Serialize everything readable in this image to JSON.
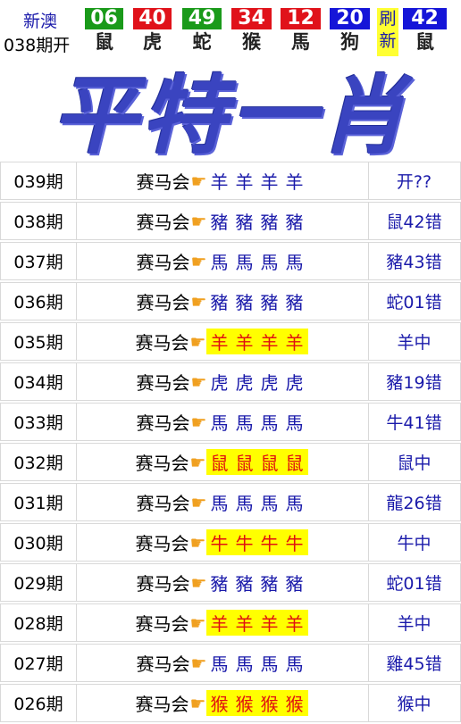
{
  "header": {
    "brand": "新澳",
    "period_open": "038期开",
    "balls": [
      {
        "num": "06",
        "zodiac": "鼠",
        "color": "#1a9a1a"
      },
      {
        "num": "40",
        "zodiac": "虎",
        "color": "#e0121a"
      },
      {
        "num": "49",
        "zodiac": "蛇",
        "color": "#1a9a1a"
      },
      {
        "num": "34",
        "zodiac": "猴",
        "color": "#e0121a"
      },
      {
        "num": "12",
        "zodiac": "馬",
        "color": "#e0121a"
      },
      {
        "num": "20",
        "zodiac": "狗",
        "color": "#1515d8"
      }
    ],
    "refresh_top": "刷",
    "refresh_bottom": "新",
    "special": {
      "num": "42",
      "zodiac": "鼠",
      "color": "#1515d8"
    }
  },
  "banner": {
    "title": "平特一肖"
  },
  "rows": [
    {
      "period": "039期",
      "source": "赛马会",
      "picks": [
        "羊",
        "羊",
        "羊",
        "羊"
      ],
      "hit": false,
      "result": "开??"
    },
    {
      "period": "038期",
      "source": "赛马会",
      "picks": [
        "豬",
        "豬",
        "豬",
        "豬"
      ],
      "hit": false,
      "result": "鼠42错"
    },
    {
      "period": "037期",
      "source": "赛马会",
      "picks": [
        "馬",
        "馬",
        "馬",
        "馬"
      ],
      "hit": false,
      "result": "豬43错"
    },
    {
      "period": "036期",
      "source": "赛马会",
      "picks": [
        "豬",
        "豬",
        "豬",
        "豬"
      ],
      "hit": false,
      "result": "蛇01错"
    },
    {
      "period": "035期",
      "source": "赛马会",
      "picks": [
        "羊",
        "羊",
        "羊",
        "羊"
      ],
      "hit": true,
      "result": "羊中"
    },
    {
      "period": "034期",
      "source": "赛马会",
      "picks": [
        "虎",
        "虎",
        "虎",
        "虎"
      ],
      "hit": false,
      "result": "豬19错"
    },
    {
      "period": "033期",
      "source": "赛马会",
      "picks": [
        "馬",
        "馬",
        "馬",
        "馬"
      ],
      "hit": false,
      "result": "牛41错"
    },
    {
      "period": "032期",
      "source": "赛马会",
      "picks": [
        "鼠",
        "鼠",
        "鼠",
        "鼠"
      ],
      "hit": true,
      "result": "鼠中"
    },
    {
      "period": "031期",
      "source": "赛马会",
      "picks": [
        "馬",
        "馬",
        "馬",
        "馬"
      ],
      "hit": false,
      "result": "龍26错"
    },
    {
      "period": "030期",
      "source": "赛马会",
      "picks": [
        "牛",
        "牛",
        "牛",
        "牛"
      ],
      "hit": true,
      "result": "牛中"
    },
    {
      "period": "029期",
      "source": "赛马会",
      "picks": [
        "豬",
        "豬",
        "豬",
        "豬"
      ],
      "hit": false,
      "result": "蛇01错"
    },
    {
      "period": "028期",
      "source": "赛马会",
      "picks": [
        "羊",
        "羊",
        "羊",
        "羊"
      ],
      "hit": true,
      "result": "羊中"
    },
    {
      "period": "027期",
      "source": "赛马会",
      "picks": [
        "馬",
        "馬",
        "馬",
        "馬"
      ],
      "hit": false,
      "result": "雞45错"
    },
    {
      "period": "026期",
      "source": "赛马会",
      "picks": [
        "猴",
        "猴",
        "猴",
        "猴"
      ],
      "hit": true,
      "result": "猴中"
    }
  ]
}
